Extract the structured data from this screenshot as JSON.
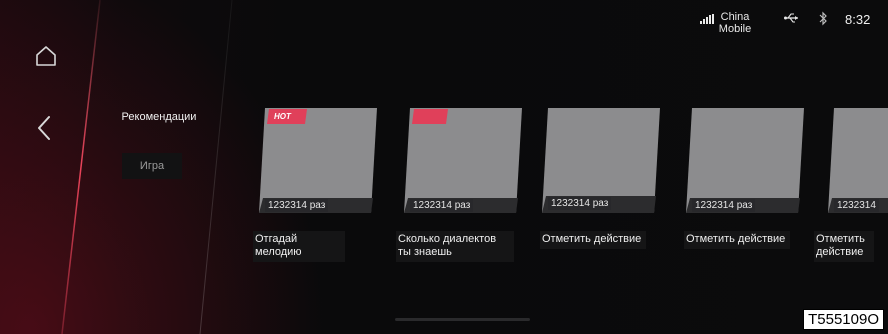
{
  "status_bar": {
    "carrier_line1": "China",
    "carrier_line2": "Mobile",
    "time": "8:32",
    "icons": [
      "signal-icon",
      "usb-icon",
      "bluetooth-icon"
    ]
  },
  "nav": {
    "icons": [
      "home-icon",
      "back-icon"
    ]
  },
  "categories": [
    {
      "label": "Рекомендации",
      "selected": true
    },
    {
      "label": "Игра",
      "selected": false
    }
  ],
  "cards": [
    {
      "title": "Отгадай мелодию",
      "count": "1232314   раз",
      "badge": "HOT"
    },
    {
      "title": "Сколько диалектов ты знаешь",
      "count": "1232314 раз",
      "badge": ""
    },
    {
      "title": "Отметить действие",
      "count": "1232314 раз",
      "badge": ""
    },
    {
      "title": "Отметить действие",
      "count": "1232314 раз",
      "badge": ""
    },
    {
      "title": "Отметить действие",
      "count": "1232314",
      "badge": ""
    }
  ],
  "figure_code": "T555109O",
  "colors": {
    "accent": "#e0405a",
    "card_bg": "#8a8a8c",
    "background": "#0b0b0c"
  }
}
